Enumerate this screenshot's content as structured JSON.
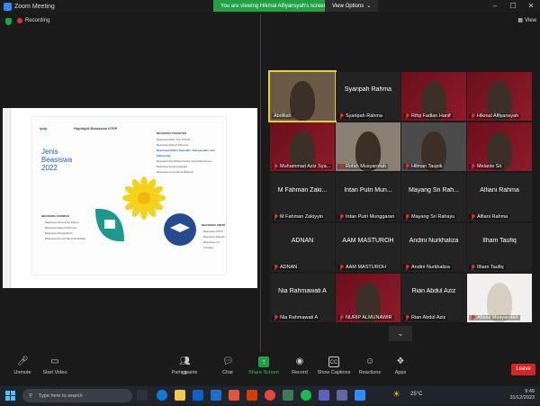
{
  "window": {
    "title": "Zoom Meeting",
    "viewing_banner": "You are viewing Hikmal Alfiyansyah's screen",
    "view_options": "View Options"
  },
  "topbar": {
    "recording": "Recording",
    "view": "View"
  },
  "slide": {
    "logo": "lpdp",
    "header": "Highlight Beasiswa LPDP",
    "title_line1": "Jenis",
    "title_line2": "Beasiswa",
    "title_line3": "2022",
    "targeted_heading": "BEASISWA TARGETED",
    "targeted_items": [
      "Beasiswa PNS, TNI, POLRI",
      "Beasiswa Daerah Afirmasi",
      "Beasiswa Dokter Spesialis, Subspesialis, dan Fellowship",
      "Beasiswa Pendidikan Kader Ulama/Pesantren",
      "Beasiswa Kewirausahaan",
      "Beasiswa Kerja Sama Bilateral"
    ],
    "afirmasi_heading": "BEASISWA AFIRMASI",
    "afirmasi_items": [
      "Beasiswa Putra-Putri Papua",
      "Beasiswa Daerah Afirmasi",
      "Beasiswa Prasejahtera",
      "Beasiswa Penyandang Disabilitas"
    ],
    "umum_heading": "BEASISWA UMUM",
    "umum_items": [
      "Beasiswa PTDN",
      "Beasiswa Reguler",
      "Beasiswa Co-Funding"
    ]
  },
  "participants": [
    {
      "name": "Abdillah",
      "video": true,
      "active": true
    },
    {
      "name": "Syaripah Rahma",
      "display": "Syaripah Rahma",
      "video": false
    },
    {
      "name": "Rifqi Fadlan Hanif",
      "video": true
    },
    {
      "name": "Hikmal Alfiyansyah",
      "video": true
    },
    {
      "name": "Muhammad Aziz Sya...",
      "video": true
    },
    {
      "name": "Rofah Musyarofah",
      "video": true
    },
    {
      "name": "Hilman Taupik",
      "video": true
    },
    {
      "name": "Melanie Sri",
      "video": true
    },
    {
      "name": "M Fahman Zakiyyin",
      "display": "M Fahman Zaki...",
      "video": false
    },
    {
      "name": "Intan Putri Munggaran",
      "display": "Intan Putri Mun...",
      "video": false
    },
    {
      "name": "Mayang Sri Rahayu",
      "display": "Mayang Sri Rah...",
      "video": false
    },
    {
      "name": "Alfiani Rahma",
      "display": "Alfiani Rahma",
      "video": false
    },
    {
      "name": "ADNAN",
      "display": "ADNAN",
      "video": false
    },
    {
      "name": "AAM MASTUROH",
      "display": "AAM MASTUROH",
      "video": false
    },
    {
      "name": "Andini Nurkhaliza",
      "display": "Andini Nurkhaliza",
      "video": false
    },
    {
      "name": "Ilham Taufiq",
      "display": "Ilham Taufiq",
      "video": false
    },
    {
      "name": "Nia Rahmawati A",
      "display": "Nia Rahmawati A",
      "video": false
    },
    {
      "name": "NURIP ALMUNAWIR",
      "video": true
    },
    {
      "name": "Rian Abdul Aziz",
      "display": "Rian Abdul Aziz",
      "video": false
    },
    {
      "name": "Afiatul Musyarofah",
      "video": true
    }
  ],
  "toolbar": {
    "unmute": "Unmute",
    "start_video": "Start Video",
    "participants": "Participants",
    "participants_count": "59",
    "chat": "Chat",
    "share_screen": "Share Screen",
    "record": "Record",
    "show_captions": "Show Captions",
    "reactions": "Reactions",
    "apps": "Apps",
    "leave": "Leave"
  },
  "taskbar": {
    "search_placeholder": "Type here to search",
    "temperature": "25°C",
    "time": "9:49",
    "date": "31/12/2023"
  },
  "colors": {
    "accent_green": "#22a046",
    "leave_red": "#d42525",
    "active_border": "#e6cf3a"
  }
}
